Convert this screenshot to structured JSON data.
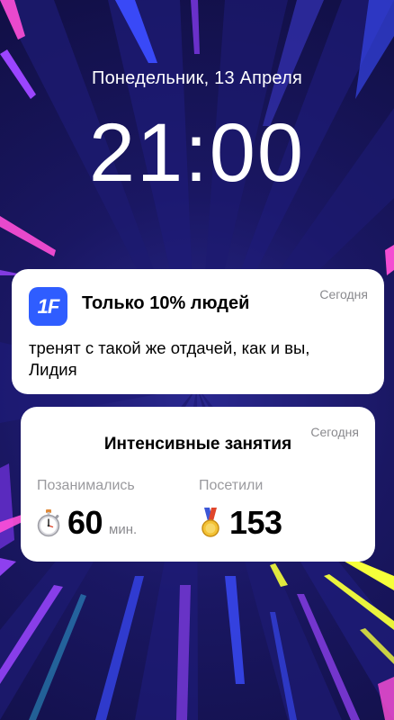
{
  "lock_screen": {
    "date": "Понедельник, 13 Апреля",
    "time": "21:00"
  },
  "notifications": [
    {
      "app_icon_text": "1F",
      "title": "Только 10% людей",
      "time": "Сегодня",
      "body": "тренят с такой же отдачей, как и вы, Лидия"
    },
    {
      "title": "Интенсивные занятия",
      "time": "Сегодня",
      "stats": [
        {
          "label": "Позанимались",
          "icon": "stopwatch-icon",
          "value": "60",
          "unit": "мин."
        },
        {
          "label": "Посетили",
          "icon": "medal-icon",
          "value": "153",
          "unit": ""
        }
      ]
    }
  ],
  "colors": {
    "background_dark": "#14114f",
    "background_mid": "#2a2890",
    "app_icon_blue": "#2f5dff",
    "ray_pink": "#ff4fd8",
    "ray_purple": "#9b45ff",
    "ray_blue": "#3b4cff",
    "ray_yellow": "#f6ff3a",
    "ray_cyan": "#38d6ff"
  }
}
